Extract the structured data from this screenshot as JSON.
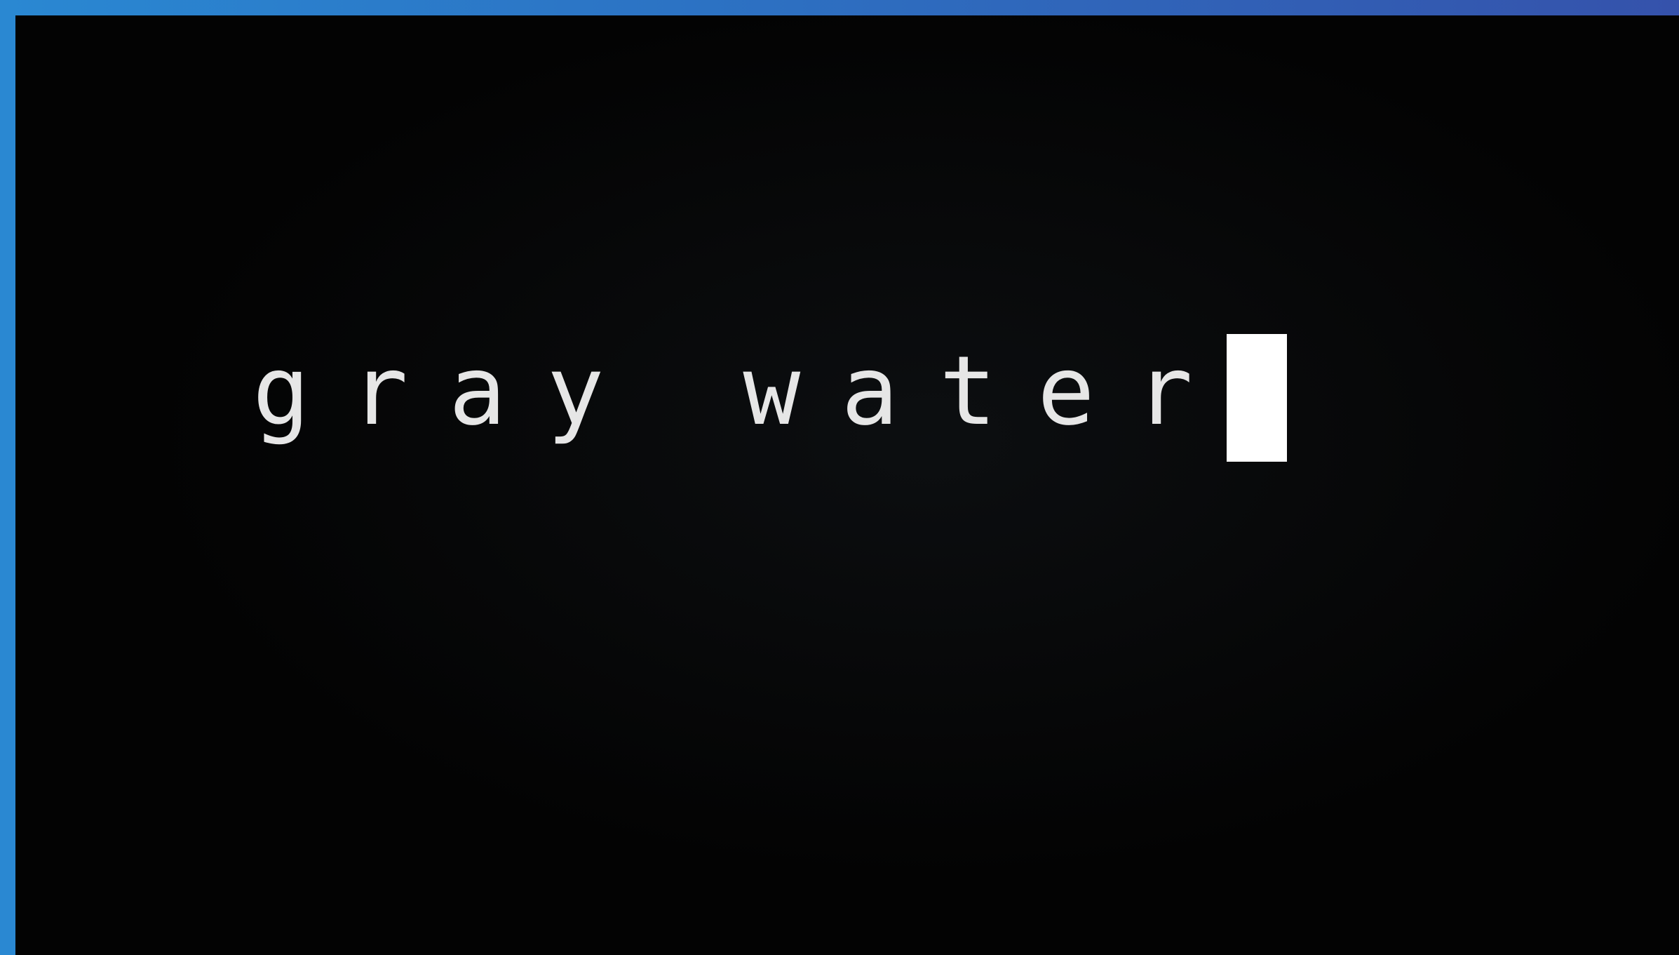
{
  "terminal": {
    "typed_text": "gray water",
    "cursor_style": "block"
  },
  "colors": {
    "frame_gradient_start": "#2a88d2",
    "frame_gradient_end": "#3552ab",
    "terminal_background": "#030303",
    "text_color": "#e6e6e6",
    "cursor_color": "#ffffff"
  }
}
